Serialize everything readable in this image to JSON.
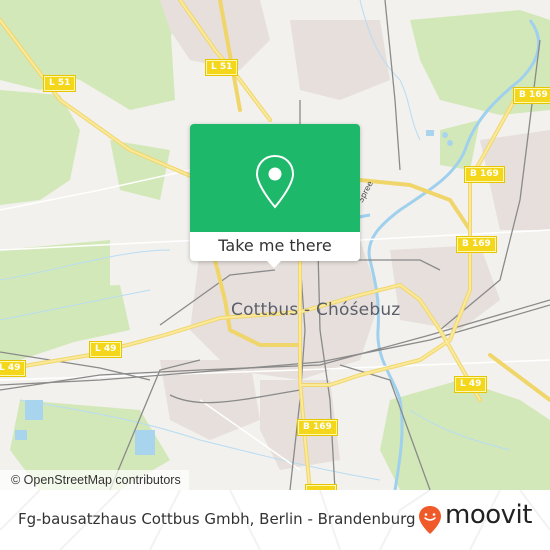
{
  "map": {
    "city_label": "Cottbus - Chóśebuz",
    "river_label": "Spree",
    "road_shields": [
      {
        "label": "L 51"
      },
      {
        "label": "L 51"
      },
      {
        "label": "B 169"
      },
      {
        "label": "B 169"
      },
      {
        "label": "B 169"
      },
      {
        "label": "B 169"
      },
      {
        "label": "L 49"
      },
      {
        "label": "L 49"
      },
      {
        "label": "L 49"
      },
      {
        "label": ""
      }
    ],
    "attribution": "© OpenStreetMap contributors",
    "colors": {
      "land": "#f2f1ed",
      "forest": "#cfe6b2",
      "urban": "#e8e2de",
      "water": "#a8d4ee",
      "major_road": "#f7e27a",
      "rail": "#8a8a8a",
      "shield": "#f4d71b"
    }
  },
  "popup": {
    "icon": "map-pin-icon",
    "button_label": "Take me there",
    "color": "#1db86a"
  },
  "footer": {
    "place_text": "Fg-bausatzhaus Cottbus Gmbh, Berlin - Brandenburg",
    "brand_icon": "moovit-pin-icon",
    "brand_name": "moovit",
    "brand_color": "#f05a28"
  }
}
